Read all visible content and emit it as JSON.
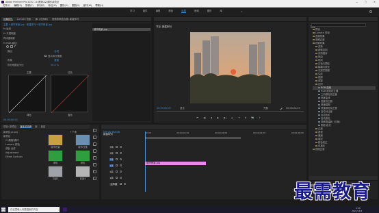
{
  "titlebar": {
    "app_title": "Adobe Premiere Pro 2020 - D:\\教案\\02\\调色\\新项目",
    "win_controls": [
      "—",
      "□",
      "✕"
    ]
  },
  "menu": [
    "文件(F)",
    "编辑(E)",
    "剪辑(C)",
    "序列(S)",
    "标记(M)",
    "图形(G)",
    "视图(V)",
    "窗口(W)",
    "帮助(H)"
  ],
  "workspaces": {
    "items": [
      "学习",
      "组件",
      "编辑",
      "颜色",
      "效果",
      "音频",
      "图形",
      "库"
    ],
    "active": "效果"
  },
  "left_panel": {
    "tabs": [
      "效果控件",
      "Lumetri 范围",
      "源: (无剪辑)",
      "音频剪辑混合器: 新建序列"
    ],
    "clip_path": "主要 * 城市夜景.jpg  ·  新建序列 * 城市夜景.jpg",
    "items": [
      "fx 运动",
      "fx 不透明度",
      "时间重映射",
      "fx RGB 曲线"
    ],
    "labels": [
      "输出",
      "显示拆分视图",
      "布局",
      "拆分视图百分比"
    ],
    "values": [
      "合成",
      "垂直",
      "50.0 %"
    ],
    "curve_labels": [
      "主要",
      "红色",
      "绿色",
      "蓝色"
    ],
    "mini_clip": "城市夜景.jpg",
    "timecode": "00;00;00;00"
  },
  "program": {
    "title": "节目: 新建序列",
    "tc_left": "00;00;00;00",
    "fit": "适合",
    "quality": "完整",
    "tc_right": "00;00;04;29",
    "controls": [
      "⏮",
      "◀|",
      "◀",
      "▶",
      "▶|",
      "⏭",
      "⇥",
      "⧉",
      "📷",
      "+"
    ]
  },
  "project": {
    "tabs": [
      "项目: 新项目",
      "媒体浏览器",
      "库",
      "信息"
    ],
    "path": "新项目.prproj",
    "count": "7 个项",
    "tree": [
      "新项目",
      "C:\\教程\\素材",
      "Lumetri 颜色",
      "调色 合成",
      "Adjustment",
      "Effect Controls"
    ],
    "bins": [
      {
        "name": "城市夜景",
        "meta": "5:00",
        "color": "#c8a040"
      },
      {
        "name": "城市日落",
        "meta": "5:00",
        "color": "#6a8fb0"
      },
      {
        "name": "绿色",
        "meta": "5:00",
        "color": "#2f9e3e"
      },
      {
        "name": "绿色",
        "meta": "5:00",
        "color": "#2f9e3e"
      },
      {
        "name": "白景3",
        "meta": "5:00",
        "color": "#9fa3a8"
      },
      {
        "name": "白景4",
        "meta": "5:00",
        "color": "#b5b5b5"
      }
    ]
  },
  "timeline": {
    "title": "新建序列",
    "timecode": "00;00;00;00",
    "ruler": [
      "00;00",
      "00;00;02;00",
      "00;00;04;00",
      "00;00;06;00",
      "00;00;08;00"
    ],
    "tracks": [
      "V3",
      "V2",
      "V1",
      "A1",
      "A2",
      "A3",
      "主声道"
    ],
    "clip": "城市夜景.jpg",
    "master_val": "0.0"
  },
  "effects": {
    "title": "效果",
    "items": [
      "预设",
      "Lumetri 预设",
      "音频效果",
      "音频过渡",
      "视频效果",
      "变换",
      "图像控制",
      "实用程序",
      "扭曲",
      "时间",
      "杂色与颗粒",
      "模糊与锐化",
      "沉浸式视频",
      "生成",
      "视频",
      "调整",
      "过时",
      "RGB 曲线",
      "RGB 颜色校正器",
      "三向颜色校正器",
      "亮度曲线",
      "亮度校正器",
      "快速模糊",
      "快速颜色校正器",
      "自动对比度",
      "自动色阶",
      "自动颜色",
      "视频限幅器（旧版）",
      "阴影/高光",
      "过渡",
      "透视",
      "通道",
      "键控",
      "颜色校正",
      "风格化",
      "视频过渡"
    ],
    "bottom_label": "基本图形"
  },
  "taskbar": {
    "search": "在这里输入你要搜索的内容",
    "clock": "9:58",
    "date": "2021/11/6"
  },
  "watermark": "最需教育",
  "colors": {
    "accent": "#3c8fd8",
    "clip_pink": "#e58be5",
    "track_green": "#2b6b3a",
    "playhead": "#3c8fd8"
  }
}
